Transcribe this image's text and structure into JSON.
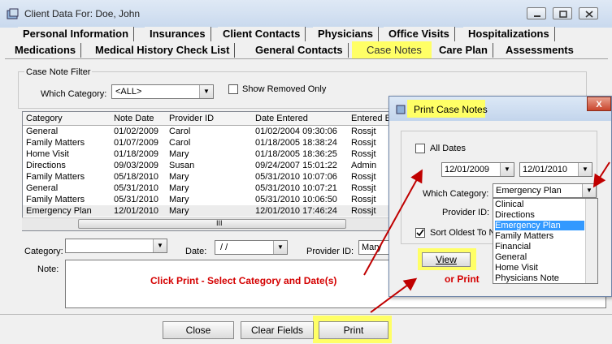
{
  "window": {
    "title": "Client Data For: Doe, John"
  },
  "tabs_row1": [
    "Personal Information",
    "Insurances",
    "Client Contacts",
    "Physicians",
    "Office Visits",
    "Hospitalizations"
  ],
  "tabs_row2": [
    "Medications",
    "Medical History Check List",
    "General Contacts",
    "Case Notes",
    "Care Plan",
    "Assessments"
  ],
  "filter": {
    "legend": "Case Note Filter",
    "which_category_label": "Which Category:",
    "which_category_value": "<ALL>",
    "show_removed_label": "Show Removed Only"
  },
  "grid": {
    "columns": [
      "Category",
      "Note Date",
      "Provider ID",
      "Date Entered",
      "Entered B"
    ],
    "rows": [
      [
        "General",
        "01/02/2009",
        "Carol",
        "01/02/2004 09:30:06",
        "Rossjt"
      ],
      [
        "Family Matters",
        "01/07/2009",
        "Carol",
        "01/18/2005 18:38:24",
        "Rossjt"
      ],
      [
        "Home Visit",
        "01/18/2009",
        "Mary",
        "01/18/2005 18:36:25",
        "Rossjt"
      ],
      [
        "Directions",
        "09/03/2009",
        "Susan",
        "09/24/2007 15:01:22",
        "Admin"
      ],
      [
        "Family Matters",
        "05/18/2010",
        "Mary",
        "05/31/2010 10:07:06",
        "Rossjt"
      ],
      [
        "General",
        "05/31/2010",
        "Mary",
        "05/31/2010 10:07:21",
        "Rossjt"
      ],
      [
        "Family Matters",
        "05/31/2010",
        "Mary",
        "05/31/2010 10:06:50",
        "Rossjt"
      ],
      [
        "Emergency Plan",
        "12/01/2010",
        "Mary",
        "12/01/2010 17:46:24",
        "Rossjt"
      ]
    ],
    "scroll_grip": "III"
  },
  "detail": {
    "category_label": "Category:",
    "date_label": "Date:",
    "date_value": " / /",
    "provider_label": "Provider ID:",
    "provider_value": "Mary",
    "note_label": "Note:"
  },
  "buttons": {
    "close": "Close",
    "clear": "Clear Fields",
    "print": "Print"
  },
  "dialog": {
    "title": "Print Case Notes",
    "close": "X",
    "all_dates_label": "All Dates",
    "date_from": "12/01/2009",
    "date_to": "12/01/2010",
    "which_category_label": "Which Category:",
    "which_category_value": "Emergency Plan",
    "provider_label": "Provider ID:",
    "sort_label": "Sort Oldest To N",
    "view_button": "View",
    "category_options": [
      "Clinical",
      "Directions",
      "Emergency Plan",
      "Family Matters",
      "Financial",
      "General",
      "Home Visit",
      "Physicians Note"
    ]
  },
  "annotations": {
    "main": "Click Print - Select Category and Date(s)",
    "or_print": "or Print"
  },
  "colors": {
    "highlight": "#ffff66",
    "annotation": "#d40000",
    "selection": "#3399ff"
  }
}
